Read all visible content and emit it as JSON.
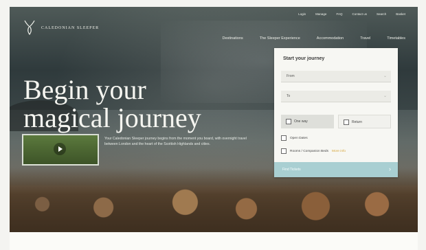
{
  "brand": {
    "name": "Caledonian Sleeper"
  },
  "utility_nav": [
    "Login",
    "Manage",
    "FAQ",
    "Contact us",
    "Search",
    "Basket"
  ],
  "main_nav": [
    "Destinations",
    "The Sleeper Experience",
    "Accommodation",
    "Travel",
    "Timetables"
  ],
  "hero": {
    "headline_line1": "Begin your",
    "headline_line2": "magical journey",
    "blurb": "Your Caledonian Sleeper journey begins from the moment you board, with overnight travel between London and the heart of the Scottish Highlands and cities."
  },
  "journey_form": {
    "title": "Start your journey",
    "from_placeholder": "From",
    "to_placeholder": "To",
    "one_way_label": "One way",
    "return_label": "Return",
    "open_dates_label": "Open Dates",
    "companion_label": "Rooms / Companion Beds",
    "companion_more": "More info",
    "submit_label": "Find Tickets"
  },
  "colors": {
    "accent_submit": "#a9cfd2",
    "accent_link": "#d6a63a"
  }
}
